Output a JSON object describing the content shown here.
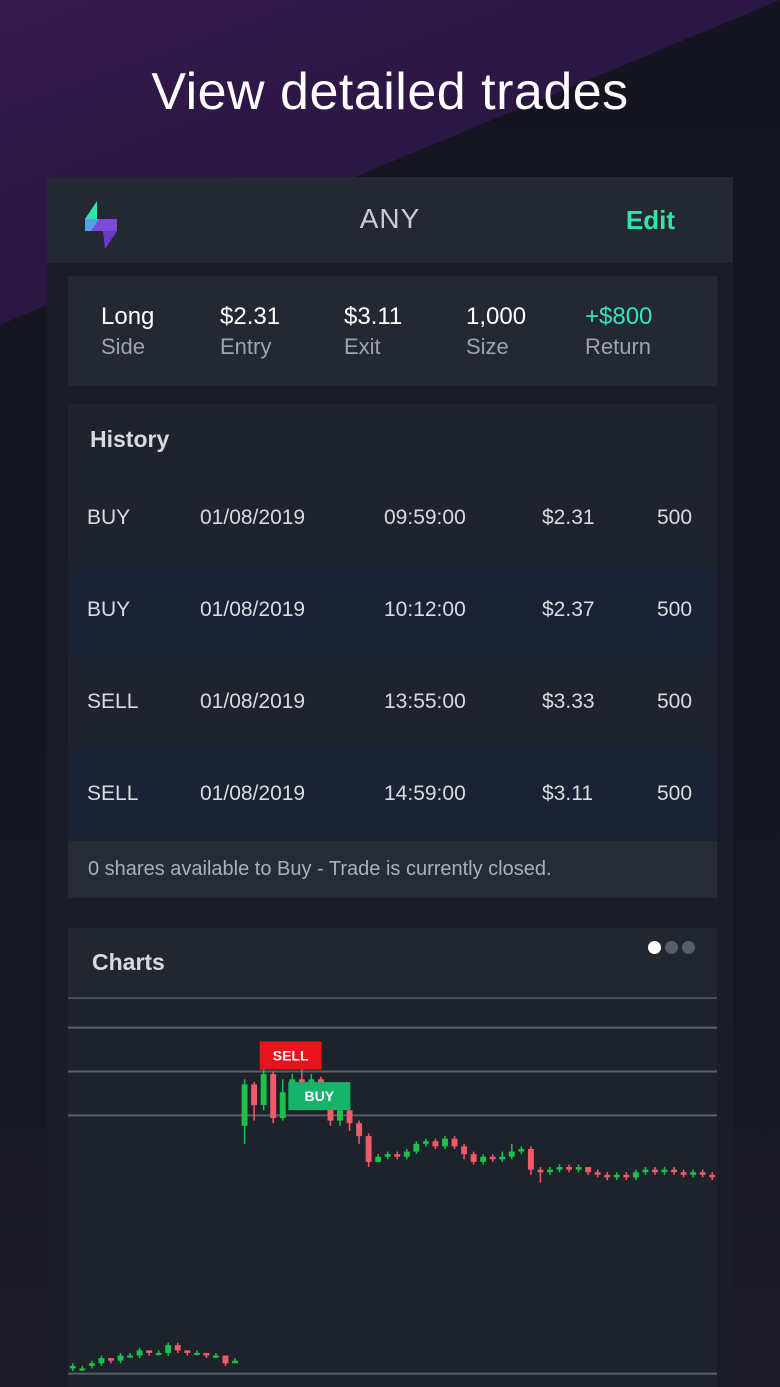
{
  "headline": "View detailed trades",
  "header": {
    "ticker": "ANY",
    "edit_label": "Edit",
    "logo_icon": "bolt-logo-icon"
  },
  "summary": {
    "side": {
      "value": "Long",
      "label": "Side"
    },
    "entry": {
      "value": "$2.31",
      "label": "Entry"
    },
    "exit": {
      "value": "$3.11",
      "label": "Exit"
    },
    "size": {
      "value": "1,000",
      "label": "Size"
    },
    "return": {
      "value": "+$800",
      "label": "Return"
    }
  },
  "history": {
    "title": "History",
    "rows": [
      {
        "action": "BUY",
        "date": "01/08/2019",
        "time": "09:59:00",
        "price": "$2.31",
        "qty": "500"
      },
      {
        "action": "BUY",
        "date": "01/08/2019",
        "time": "10:12:00",
        "price": "$2.37",
        "qty": "500"
      },
      {
        "action": "SELL",
        "date": "01/08/2019",
        "time": "13:55:00",
        "price": "$3.33",
        "qty": "500"
      },
      {
        "action": "SELL",
        "date": "01/08/2019",
        "time": "14:59:00",
        "price": "$3.11",
        "qty": "500"
      }
    ],
    "note": "0 shares available to Buy - Trade is currently closed."
  },
  "charts": {
    "title": "Charts",
    "page_dots": {
      "count": 3,
      "active": 0
    },
    "sell_marker": "SELL",
    "buy_marker": "BUY"
  },
  "colors": {
    "accent_green": "#2ee6a6",
    "return_green": "#2ee6c0",
    "candle_up": "#19c24a",
    "candle_down": "#f25a6a",
    "sell_marker": "#e8131b",
    "buy_marker": "#16b36a"
  },
  "chart_data": {
    "type": "candlestick",
    "candles": [
      [
        2.18,
        2.19,
        2.17,
        2.2
      ],
      [
        2.18,
        2.18,
        2.17,
        2.19
      ],
      [
        2.19,
        2.2,
        2.18,
        2.21
      ],
      [
        2.2,
        2.22,
        2.19,
        2.23
      ],
      [
        2.22,
        2.21,
        2.2,
        2.22
      ],
      [
        2.21,
        2.23,
        2.2,
        2.24
      ],
      [
        2.23,
        2.23,
        2.22,
        2.24
      ],
      [
        2.23,
        2.25,
        2.22,
        2.26
      ],
      [
        2.25,
        2.24,
        2.23,
        2.25
      ],
      [
        2.24,
        2.24,
        2.23,
        2.25
      ],
      [
        2.24,
        2.27,
        2.23,
        2.28
      ],
      [
        2.27,
        2.25,
        2.24,
        2.28
      ],
      [
        2.25,
        2.24,
        2.23,
        2.25
      ],
      [
        2.24,
        2.24,
        2.23,
        2.25
      ],
      [
        2.24,
        2.23,
        2.22,
        2.24
      ],
      [
        2.23,
        2.23,
        2.22,
        2.24
      ],
      [
        2.23,
        2.2,
        2.19,
        2.23
      ],
      [
        2.2,
        2.21,
        2.2,
        2.22
      ],
      [
        3.12,
        3.28,
        3.05,
        3.3
      ],
      [
        3.28,
        3.2,
        3.14,
        3.29
      ],
      [
        3.2,
        3.32,
        3.18,
        3.4
      ],
      [
        3.32,
        3.15,
        3.13,
        3.33
      ],
      [
        3.15,
        3.25,
        3.14,
        3.3
      ],
      [
        3.25,
        3.3,
        3.2,
        3.32
      ],
      [
        3.3,
        3.24,
        3.18,
        3.34
      ],
      [
        3.24,
        3.3,
        3.22,
        3.32
      ],
      [
        3.3,
        3.23,
        3.18,
        3.31
      ],
      [
        3.23,
        3.14,
        3.12,
        3.24
      ],
      [
        3.14,
        3.18,
        3.12,
        3.2
      ],
      [
        3.18,
        3.13,
        3.1,
        3.19
      ],
      [
        3.13,
        3.08,
        3.05,
        3.14
      ],
      [
        3.08,
        2.98,
        2.96,
        3.09
      ],
      [
        2.98,
        3.0,
        2.98,
        3.01
      ],
      [
        3.0,
        3.01,
        2.99,
        3.02
      ],
      [
        3.01,
        3.0,
        2.99,
        3.02
      ],
      [
        3.0,
        3.02,
        2.99,
        3.03
      ],
      [
        3.02,
        3.05,
        3.01,
        3.06
      ],
      [
        3.05,
        3.06,
        3.04,
        3.07
      ],
      [
        3.06,
        3.04,
        3.03,
        3.07
      ],
      [
        3.04,
        3.07,
        3.03,
        3.08
      ],
      [
        3.07,
        3.04,
        3.03,
        3.08
      ],
      [
        3.04,
        3.01,
        2.99,
        3.05
      ],
      [
        3.01,
        2.98,
        2.97,
        3.02
      ],
      [
        2.98,
        3.0,
        2.97,
        3.01
      ],
      [
        3.0,
        2.99,
        2.98,
        3.01
      ],
      [
        2.99,
        3.0,
        2.98,
        3.02
      ],
      [
        3.0,
        3.02,
        2.99,
        3.05
      ],
      [
        3.02,
        3.03,
        3.01,
        3.04
      ],
      [
        3.03,
        2.95,
        2.93,
        3.04
      ],
      [
        2.95,
        2.94,
        2.9,
        2.96
      ],
      [
        2.94,
        2.95,
        2.93,
        2.96
      ],
      [
        2.95,
        2.96,
        2.94,
        2.97
      ],
      [
        2.96,
        2.95,
        2.94,
        2.97
      ],
      [
        2.95,
        2.96,
        2.94,
        2.97
      ],
      [
        2.96,
        2.94,
        2.93,
        2.96
      ],
      [
        2.94,
        2.93,
        2.92,
        2.95
      ],
      [
        2.93,
        2.92,
        2.91,
        2.94
      ],
      [
        2.92,
        2.93,
        2.91,
        2.94
      ],
      [
        2.93,
        2.92,
        2.91,
        2.94
      ],
      [
        2.92,
        2.94,
        2.91,
        2.95
      ],
      [
        2.94,
        2.95,
        2.93,
        2.96
      ],
      [
        2.95,
        2.94,
        2.93,
        2.96
      ],
      [
        2.94,
        2.95,
        2.93,
        2.96
      ],
      [
        2.95,
        2.94,
        2.93,
        2.96
      ],
      [
        2.94,
        2.93,
        2.92,
        2.95
      ],
      [
        2.93,
        2.94,
        2.92,
        2.95
      ],
      [
        2.94,
        2.93,
        2.92,
        2.95
      ],
      [
        2.93,
        2.92,
        2.91,
        2.94
      ]
    ],
    "candle_fields": [
      "open",
      "close",
      "low",
      "high"
    ],
    "sell_marker_index": 20,
    "buy_marker_index": 23,
    "grid_levels": [
      3.5,
      3.33,
      3.16,
      2.16
    ]
  }
}
